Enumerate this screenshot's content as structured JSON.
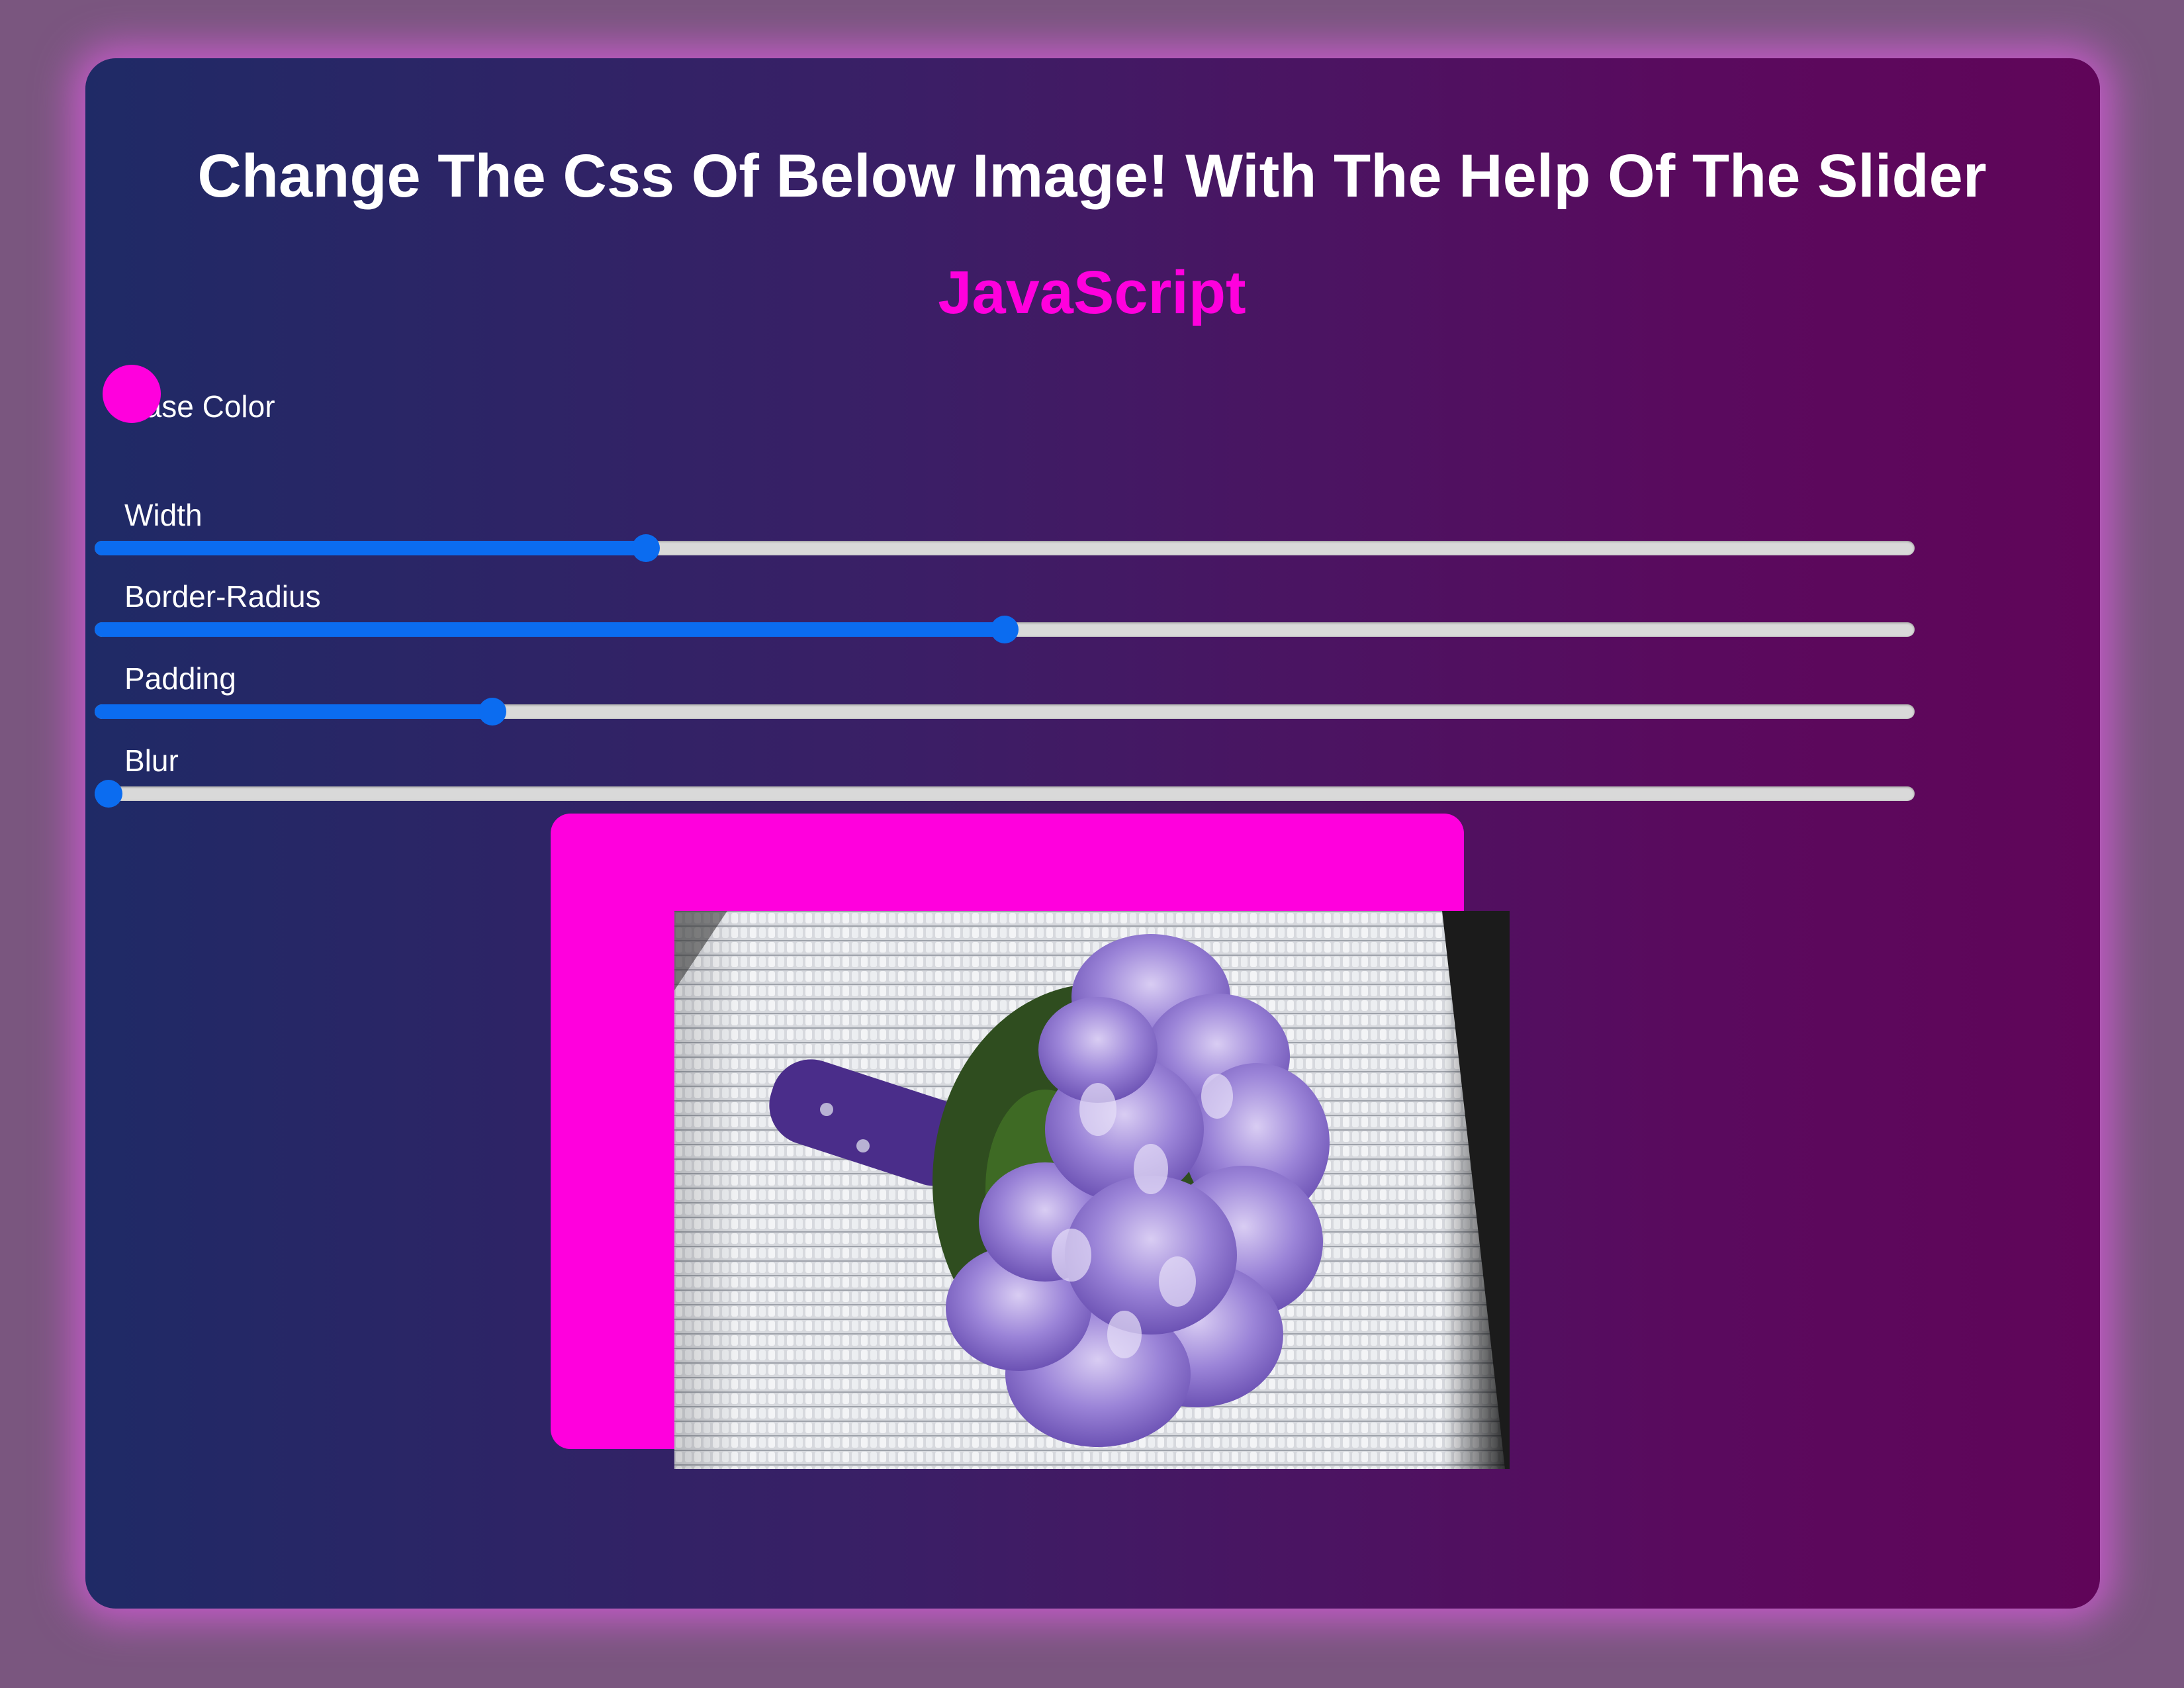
{
  "heading": {
    "title": "Change The Css Of Below Image! With The Help Of The Slider",
    "subtitle": "JavaScript"
  },
  "colors": {
    "accent": "#ff00dd",
    "slider_fill": "#0b6cf0",
    "slider_track": "#d9d9d9"
  },
  "controls": {
    "base_color": {
      "label": "Base Color",
      "value": "#ff00dd"
    },
    "width": {
      "label": "Width",
      "value_fraction": 0.3
    },
    "border_radius": {
      "label": "Border-Radius",
      "value_fraction": 0.5
    },
    "padding": {
      "label": "Padding",
      "value_fraction": 0.214
    },
    "blur": {
      "label": "Blur",
      "value_fraction": 0.0
    }
  },
  "image": {
    "subject": "purple-flower-bouquet"
  }
}
